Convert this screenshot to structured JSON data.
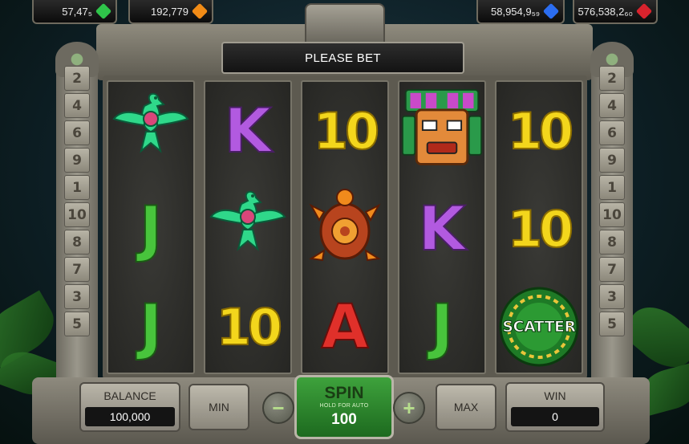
{
  "jackpots": [
    {
      "value": "57,47₅",
      "gem": "green-gem",
      "color": "#2fc44a"
    },
    {
      "value": "192,779",
      "gem": "orange-gem",
      "color": "#f28b16"
    },
    {
      "value": "58,954,9₅₉",
      "gem": "blue-gem",
      "color": "#2b6df0"
    },
    {
      "value": "576,538,2₆₀",
      "gem": "red-gem",
      "color": "#d8232d"
    }
  ],
  "message": "PLEASE BET",
  "paylines_left": [
    "2",
    "4",
    "6",
    "9",
    "1",
    "10",
    "8",
    "7",
    "3",
    "5"
  ],
  "paylines_right": [
    "2",
    "4",
    "6",
    "9",
    "1",
    "10",
    "8",
    "7",
    "3",
    "5"
  ],
  "reels": [
    [
      {
        "type": "bird-icon"
      },
      {
        "type": "letter",
        "text": "J",
        "cls": "J"
      },
      {
        "type": "letter",
        "text": "J",
        "cls": "J"
      }
    ],
    [
      {
        "type": "letter",
        "text": "K",
        "cls": "K"
      },
      {
        "type": "bird-icon"
      },
      {
        "type": "ten",
        "text": "10"
      }
    ],
    [
      {
        "type": "ten",
        "text": "10"
      },
      {
        "type": "turtle-icon"
      },
      {
        "type": "letter",
        "text": "A",
        "cls": "A"
      }
    ],
    [
      {
        "type": "mask-icon"
      },
      {
        "type": "letter",
        "text": "K",
        "cls": "K"
      },
      {
        "type": "letter",
        "text": "J",
        "cls": "J"
      }
    ],
    [
      {
        "type": "ten",
        "text": "10"
      },
      {
        "type": "ten",
        "text": "10"
      },
      {
        "type": "scatter-icon",
        "text": "SCATTER"
      }
    ]
  ],
  "controls": {
    "balance_label": "BALANCE",
    "balance_value": "100,000",
    "min_label": "MIN",
    "minus": "−",
    "spin_label": "SPIN",
    "spin_sub": "HOLD FOR AUTO",
    "bet_value": "100",
    "plus": "+",
    "max_label": "MAX",
    "win_label": "WIN",
    "win_value": "0"
  }
}
